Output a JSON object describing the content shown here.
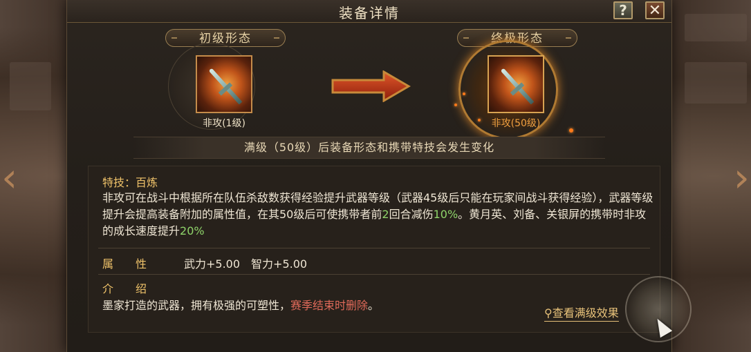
{
  "header": {
    "title": "装备详情",
    "help_label": "?",
    "close_label": "✕"
  },
  "forms": {
    "initial_label": "初级形态",
    "final_label": "终极形态",
    "initial_item_name": "非攻(1级)",
    "final_item_name": "非攻(50级)"
  },
  "notice": "满级（50级）后装备形态和携带特技会发生变化",
  "skill": {
    "title": "特技：百炼",
    "desc_part1": "非攻可在战斗中根据所在队伍杀敌数获得经验提升武器等级（武器45级后只能在玩家间战斗获得经验），武器等级提升会提高装备附加的属性值，在其50级后可使携带者前",
    "desc_rounds": "2",
    "desc_part2": "回合减伤",
    "desc_reduce": "10%",
    "desc_part3": "。黄月英、刘备、关银屏的携带时非攻的成长速度提升",
    "desc_growth": "20%"
  },
  "attributes": {
    "label": "属　　性",
    "values": "武力+5.00　智力+5.00"
  },
  "intro": {
    "label": "介　　绍",
    "text_part1": "墨家打造的武器，拥有极强的可塑性，",
    "text_highlight": "赛季结束时删除",
    "text_part2": "。"
  },
  "view_max_effect": "查看满级效果",
  "colors": {
    "accent_gold": "#f0c36a",
    "highlight_green": "#8fd46a",
    "highlight_red": "#e06a5a",
    "final_name_orange": "#f0a040"
  }
}
